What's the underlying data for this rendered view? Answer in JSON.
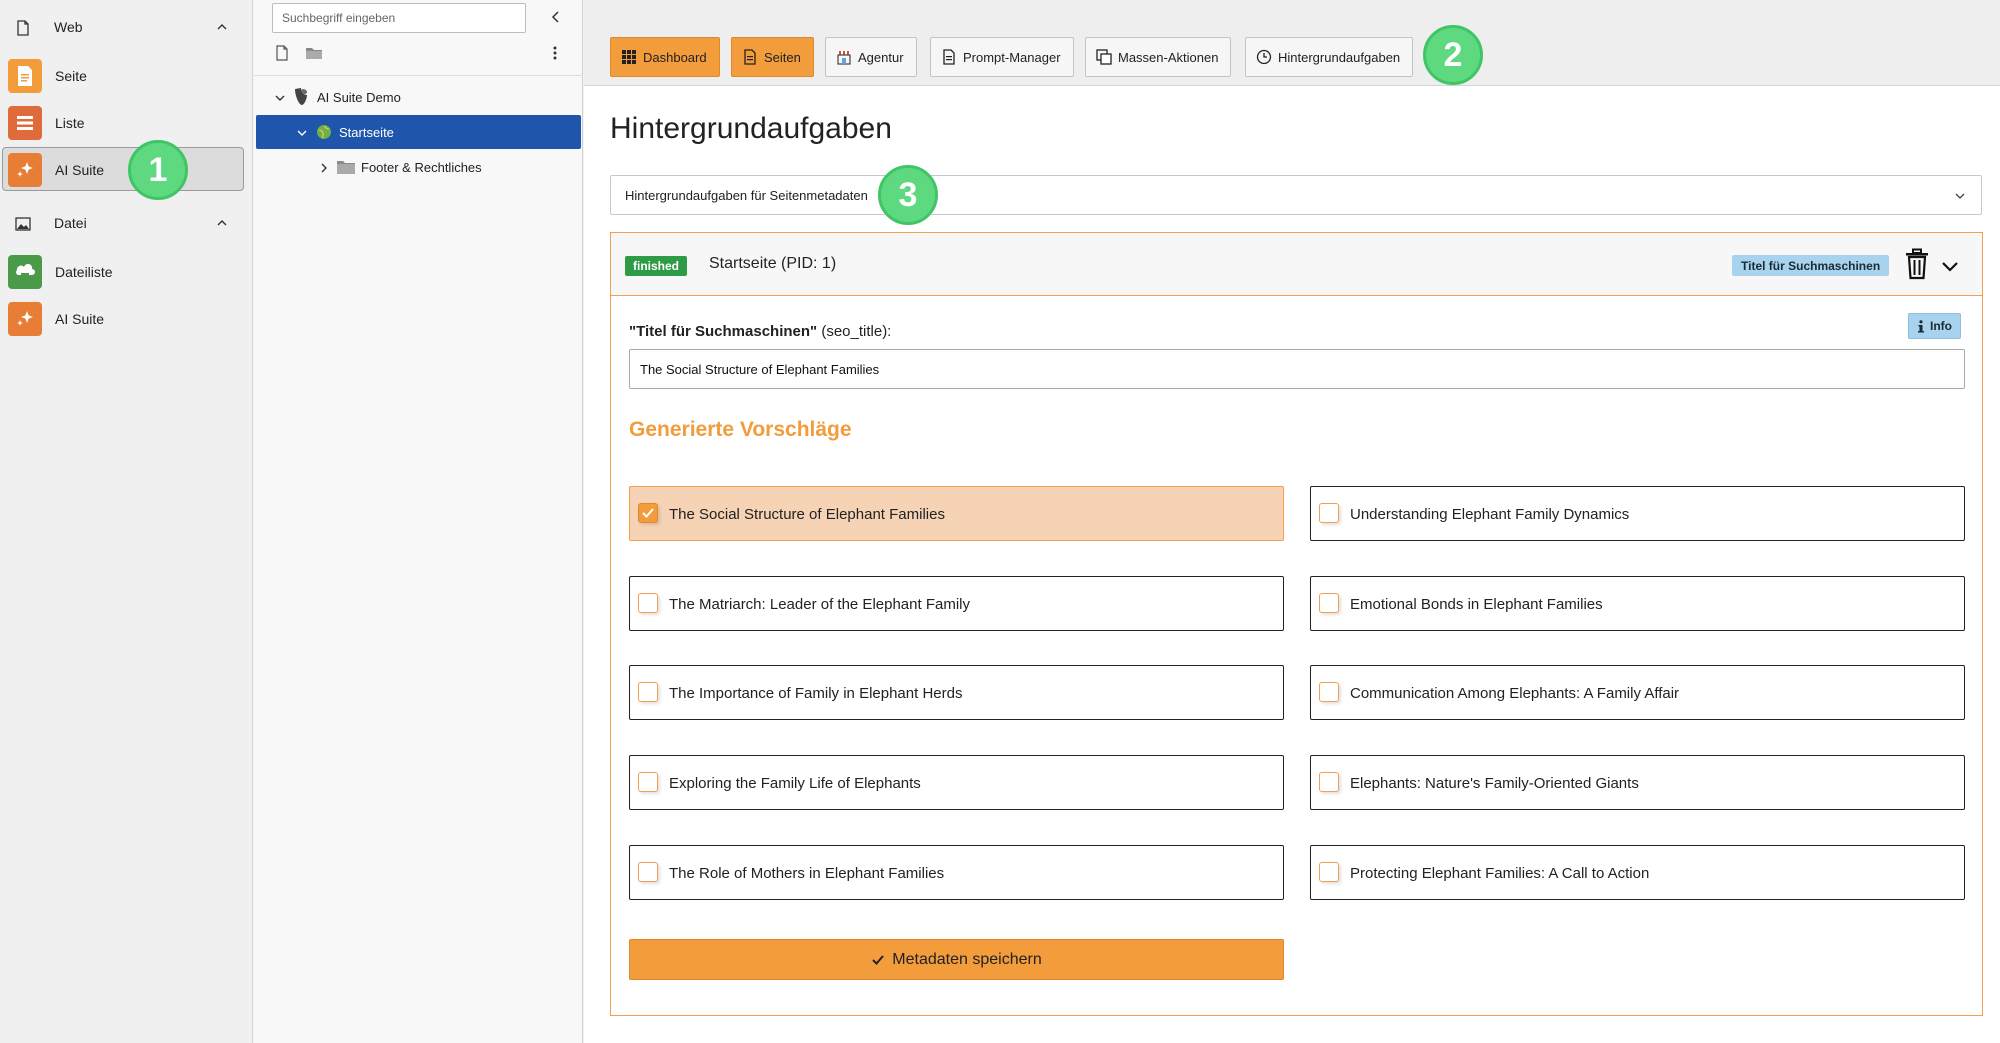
{
  "module_menu": {
    "groups": [
      {
        "label": "Web",
        "icon": "page-icon"
      },
      {
        "label": "Datei",
        "icon": "image-icon"
      }
    ],
    "items": [
      {
        "label": "Seite",
        "icon": "page-module-icon",
        "color": "#f39c3c"
      },
      {
        "label": "Liste",
        "icon": "list-module-icon",
        "color": "#e06b3a"
      },
      {
        "label": "AI Suite",
        "icon": "ai-sparkle-icon",
        "color": "#e87e35",
        "active": true
      },
      {
        "label": "Dateiliste",
        "icon": "filelist-module-icon",
        "color": "#4a9a4a"
      },
      {
        "label": "AI Suite",
        "icon": "ai-sparkle-icon",
        "color": "#e87e35"
      }
    ]
  },
  "tree": {
    "search_placeholder": "Suchbegriff eingeben",
    "nodes": [
      {
        "label": "AI Suite Demo"
      },
      {
        "label": "Startseite",
        "selected": true
      },
      {
        "label": "Footer & Rechtliches"
      }
    ]
  },
  "toolbar": {
    "buttons": [
      {
        "label": "Dashboard",
        "icon": "grid-icon",
        "active": true
      },
      {
        "label": "Seiten",
        "icon": "document-icon",
        "active": true
      },
      {
        "label": "Agentur",
        "icon": "store-icon",
        "active": false
      },
      {
        "label": "Prompt-Manager",
        "icon": "document-icon",
        "active": false
      },
      {
        "label": "Massen-Aktionen",
        "icon": "copy-icon",
        "active": false
      },
      {
        "label": "Hintergrundaufgaben",
        "icon": "clock-icon",
        "active": false
      }
    ]
  },
  "markers": [
    "1",
    "2",
    "3"
  ],
  "page": {
    "title": "Hintergrundaufgaben",
    "task_select_value": "Hintergrundaufgaben für Seitenmetadaten"
  },
  "task": {
    "status": "finished",
    "title": "Startseite (PID: 1)",
    "field_badge": "Titel für Suchmaschinen",
    "field_label_bold": "\"Titel für Suchmaschinen\"",
    "field_label_rest": " (seo_title):",
    "info_label": "Info",
    "current_value": "The Social Structure of Elephant Families",
    "suggestions_heading": "Generierte Vorschläge",
    "suggestions": [
      {
        "text": "The Social Structure of Elephant Families",
        "checked": true
      },
      {
        "text": "Understanding Elephant Family Dynamics",
        "checked": false
      },
      {
        "text": "The Matriarch: Leader of the Elephant Family",
        "checked": false
      },
      {
        "text": "Emotional Bonds in Elephant Families",
        "checked": false
      },
      {
        "text": "The Importance of Family in Elephant Herds",
        "checked": false
      },
      {
        "text": "Communication Among Elephants: A Family Affair",
        "checked": false
      },
      {
        "text": "Exploring the Family Life of Elephants",
        "checked": false
      },
      {
        "text": "Elephants: Nature's Family-Oriented Giants",
        "checked": false
      },
      {
        "text": "The Role of Mothers in Elephant Families",
        "checked": false
      },
      {
        "text": "Protecting Elephant Families: A Call to Action",
        "checked": false
      }
    ],
    "save_label": "Metadaten speichern"
  },
  "colors": {
    "accent": "#f39c3c",
    "selected_tree": "#1f56ac",
    "status_finished": "#2e9b47",
    "marker": "#5fd97f"
  }
}
